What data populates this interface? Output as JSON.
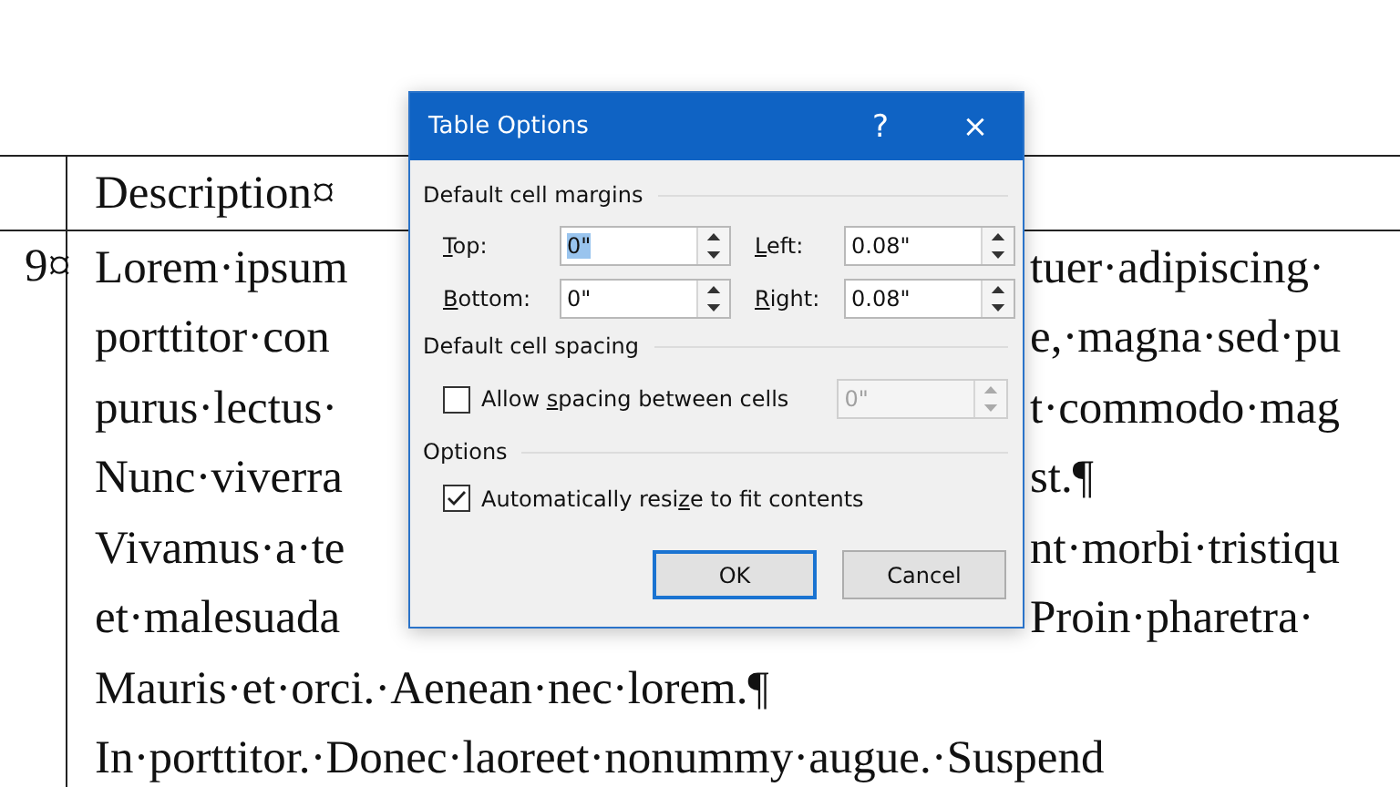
{
  "document": {
    "table": {
      "header": {
        "column_2": "Description¤"
      },
      "row": {
        "column_1": "9¤",
        "lines": [
          {
            "left": "Lorem·ipsum",
            "right": "tuer·adipiscing·"
          },
          {
            "left": "porttitor·con",
            "right": "e,·magna·sed·pu"
          },
          {
            "left": "purus·lectus·",
            "right": "t·commodo·mag"
          },
          {
            "left": "Nunc·viverra",
            "right": "st.¶"
          },
          {
            "left": "Vivamus·a·te",
            "right": "nt·morbi·tristiqu"
          },
          {
            "left": "et·malesuada",
            "right": "Proin·pharetra·"
          },
          {
            "left": "Mauris·et·orci.·Aenean·nec·lorem.¶"
          },
          {
            "left": "In·porttitor.·Donec·laoreet·nonummy·augue.·Suspend"
          }
        ]
      }
    }
  },
  "dialog": {
    "title": "Table Options",
    "help": "?",
    "close": "×",
    "sections": [
      {
        "kind": "margins",
        "title": "Default cell margins",
        "fields": [
          {
            "key": "T",
            "post": "op:",
            "value": "0\"",
            "highlighted": true
          },
          {
            "key": "L",
            "post": "eft:",
            "value": "0.08\"",
            "highlighted": false
          },
          {
            "key": "B",
            "post": "ottom:",
            "value": "0\"",
            "highlighted": false
          },
          {
            "key": "R",
            "post": "ight:",
            "value": "0.08\"",
            "highlighted": false
          }
        ]
      },
      {
        "kind": "spacing",
        "title": "Default cell spacing",
        "checkbox": {
          "pre": "Allow ",
          "key": "s",
          "post": "pacing between cells",
          "checked": false
        },
        "field": {
          "value": "0\"",
          "disabled": true
        }
      },
      {
        "kind": "options",
        "title": "Options",
        "checkbox": {
          "pre": "Automatically resi",
          "key": "z",
          "post": "e to fit contents",
          "checked": true
        }
      }
    ],
    "buttons": [
      {
        "label": "OK",
        "default": true
      },
      {
        "label": "Cancel",
        "default": false
      }
    ]
  }
}
